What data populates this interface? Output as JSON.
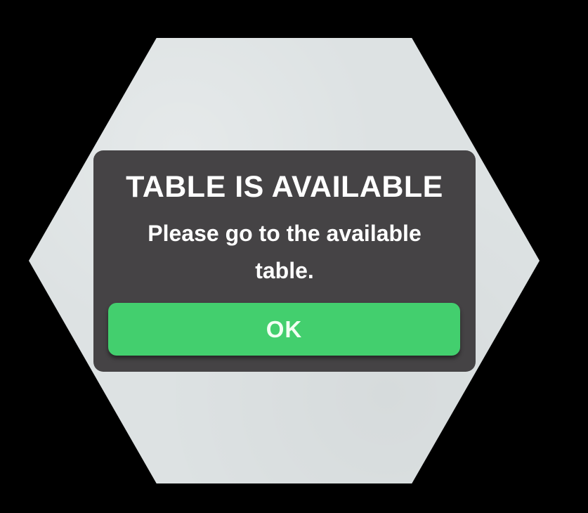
{
  "dialog": {
    "title": "TABLE IS AVAILABLE",
    "message": "Please go to the available table.",
    "ok_label": "OK"
  },
  "colors": {
    "background": "#000000",
    "hexagon": "#dde2e3",
    "dialog_background": "#454345",
    "ok_button": "#43cf6e",
    "text": "#ffffff"
  }
}
